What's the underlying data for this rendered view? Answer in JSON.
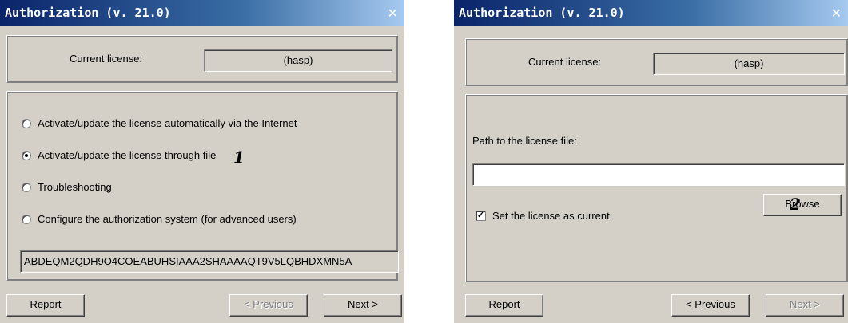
{
  "left_dialog": {
    "title": "Authorization (v. 21.0)",
    "close_icon": "✕",
    "current_license_label": "Current license:",
    "current_license_value": "(hasp)",
    "options": [
      {
        "label": "Activate/update the license automatically via the Internet",
        "checked": false
      },
      {
        "label": "Activate/update the license through file",
        "checked": true
      },
      {
        "label": "Troubleshooting",
        "checked": false
      },
      {
        "label": "Configure the authorization system (for advanced users)",
        "checked": false
      }
    ],
    "license_key": "ABDEQM2QDH9O4COEABUHSIAAA2SHAAAAQT9V5LQBHDXMN5A",
    "annotation": "1",
    "buttons": {
      "report": "Report",
      "previous": "< Previous",
      "next": "Next >"
    }
  },
  "right_dialog": {
    "title": "Authorization (v. 21.0)",
    "close_icon": "✕",
    "current_license_label": "Current license:",
    "current_license_value": "(hasp)",
    "path_label": "Path to the license file:",
    "path_value": "",
    "browse_label": "Browse",
    "set_current_label": "Set the license as current",
    "set_current_checked": true,
    "checkmark": "✓",
    "annotation": "2",
    "buttons": {
      "report": "Report",
      "previous": "< Previous",
      "next": "Next >"
    }
  }
}
